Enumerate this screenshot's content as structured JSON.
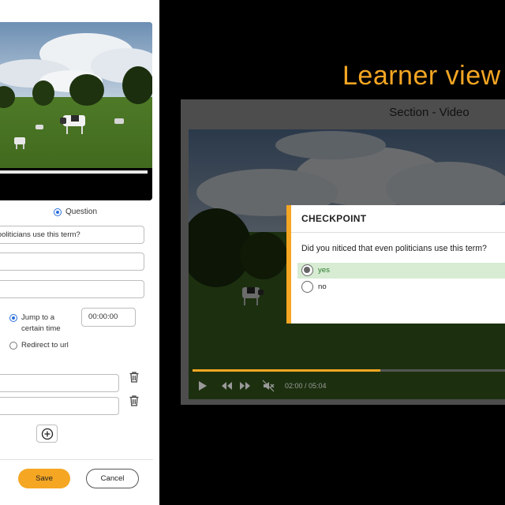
{
  "editor": {
    "video": {
      "progress_fraction": 1.0
    },
    "controls": [
      {
        "name": "closed-captions-icon"
      },
      {
        "name": "picture-in-picture-icon"
      },
      {
        "name": "gear-icon"
      },
      {
        "name": "fullscreen-icon"
      }
    ],
    "type_option_label": "Question",
    "question_value": "Did you niticed that even politicians use this term?",
    "option_jump_label": "Jump to a certain time",
    "option_redirect_label": "Redirect to url",
    "jump_time_value": "00:00:00",
    "save_label": "Save",
    "cancel_label": "Cancel"
  },
  "learner": {
    "heading": "Learner view",
    "section_title": "Section - Video",
    "checkpoint": {
      "title": "CHECKPOINT",
      "question": "Did you niticed that even politicians use this term?",
      "options": [
        {
          "label": "yes",
          "selected": true
        },
        {
          "label": "no",
          "selected": false
        }
      ]
    },
    "player": {
      "time": "02:00 / 05:04",
      "progress_fraction": 0.6
    }
  },
  "colors": {
    "accent": "#f5a623",
    "selected_option": "#d7ecd3",
    "radio_blue": "#2a6fdb"
  }
}
